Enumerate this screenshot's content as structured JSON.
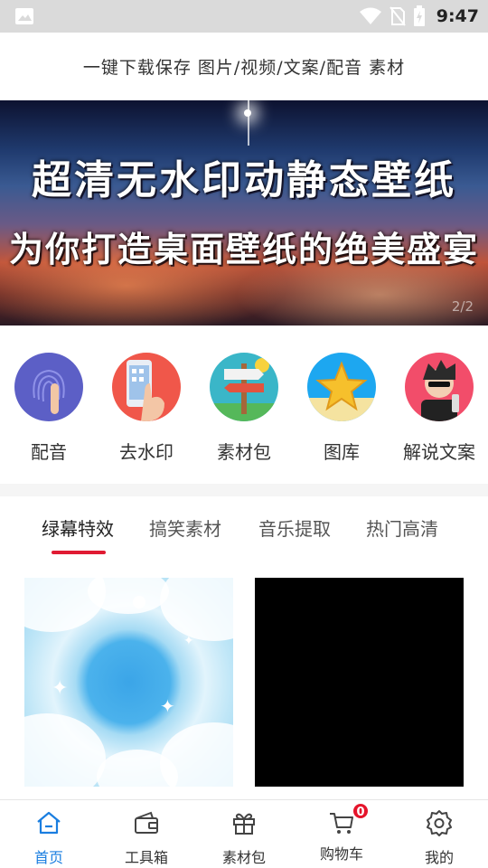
{
  "status_bar": {
    "time": "9:47",
    "icons": [
      "image-icon",
      "wifi-icon",
      "no-sim-icon",
      "battery-icon"
    ]
  },
  "header": {
    "title": "一键下载保存 图片/视频/文案/配音 素材"
  },
  "banner": {
    "line1": "超清无水印动静态壁纸",
    "line2": "为你打造桌面壁纸的绝美盛宴",
    "page_indicator": "2/2"
  },
  "quick_actions": [
    {
      "label": "配音",
      "icon": "fingerprint-icon",
      "color": "#5c5fc6"
    },
    {
      "label": "去水印",
      "icon": "phone-touch-icon",
      "color": "#f0574a"
    },
    {
      "label": "素材包",
      "icon": "signpost-icon",
      "color": "#3ab6c8"
    },
    {
      "label": "图库",
      "icon": "starfish-icon",
      "color": "#1da7f0"
    },
    {
      "label": "解说文案",
      "icon": "cartoon-avatar-icon",
      "color": "#f24d6a"
    }
  ],
  "category_tabs": [
    {
      "label": "绿幕特效",
      "active": true
    },
    {
      "label": "搞笑素材",
      "active": false
    },
    {
      "label": "音乐提取",
      "active": false
    },
    {
      "label": "热门高清",
      "active": false
    }
  ],
  "bottom_nav": [
    {
      "label": "首页",
      "icon": "home-icon",
      "active": true
    },
    {
      "label": "工具箱",
      "icon": "wallet-icon",
      "active": false
    },
    {
      "label": "素材包",
      "icon": "gift-icon",
      "active": false
    },
    {
      "label": "购物车",
      "icon": "cart-icon",
      "active": false,
      "badge": "0"
    },
    {
      "label": "我的",
      "icon": "settings-icon",
      "active": false
    }
  ],
  "colors": {
    "accent": "#1a7ee0",
    "tab_indicator": "#e01b33",
    "badge": "#e5142b"
  }
}
